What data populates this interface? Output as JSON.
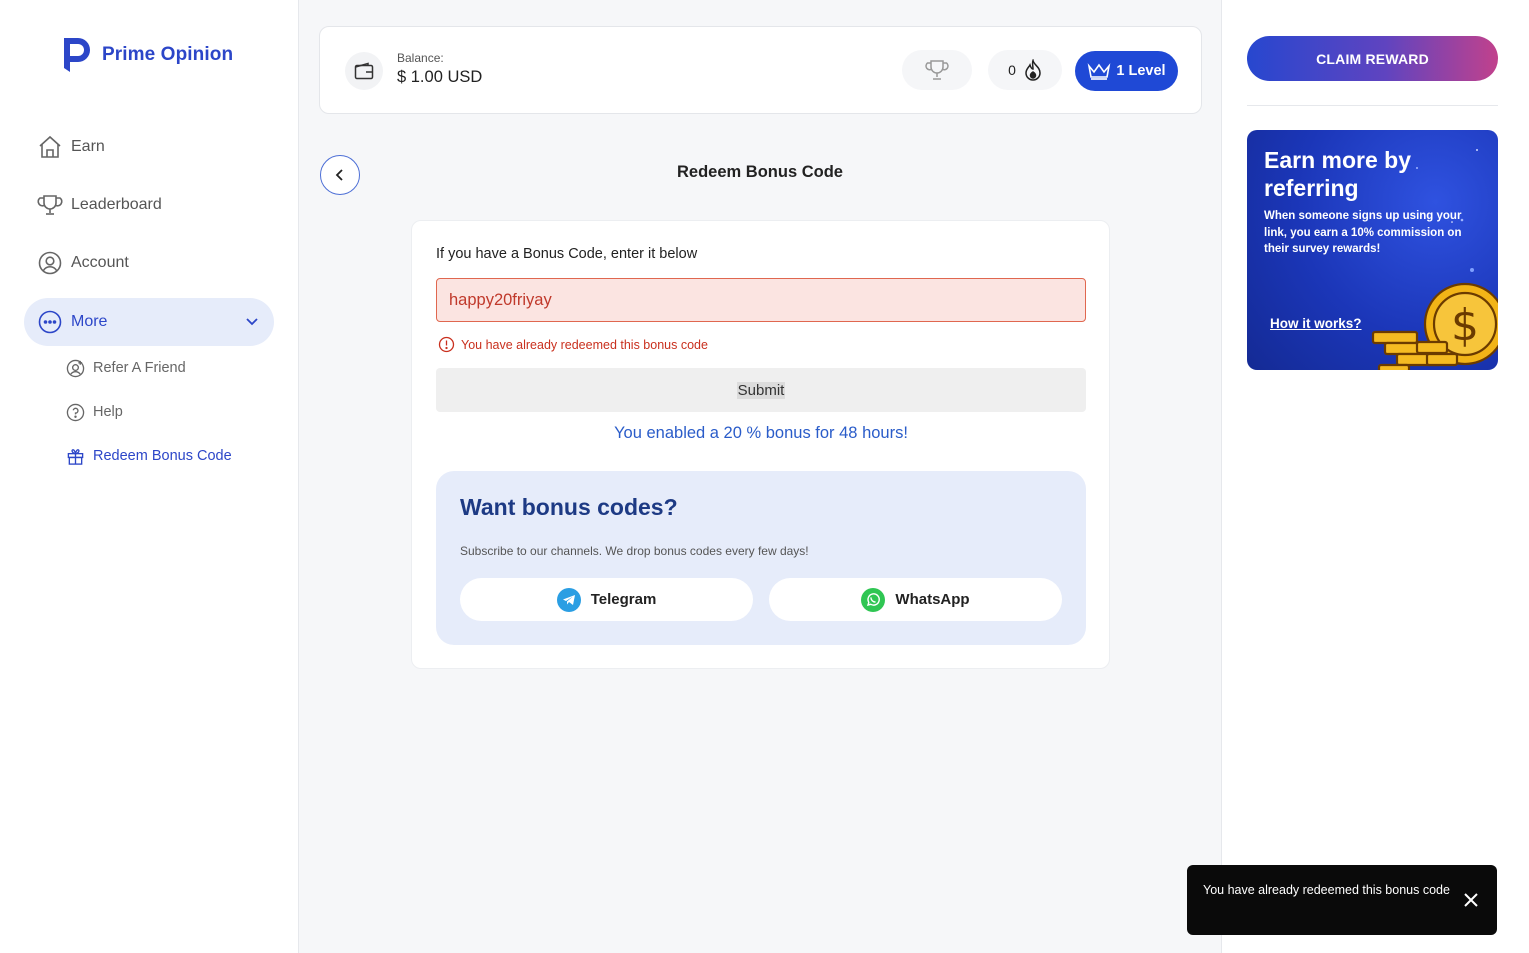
{
  "app": {
    "brand": "Prime Opinion"
  },
  "sidebar": {
    "items": [
      {
        "label": "Earn",
        "icon": "home-icon"
      },
      {
        "label": "Leaderboard",
        "icon": "trophy-icon"
      },
      {
        "label": "Account",
        "icon": "user-circle-icon"
      },
      {
        "label": "More",
        "icon": "more-circle-icon",
        "expanded": true
      }
    ],
    "sub_items": [
      {
        "label": "Refer A Friend",
        "icon": "refer-friend-icon"
      },
      {
        "label": "Help",
        "icon": "help-icon"
      },
      {
        "label": "Redeem Bonus Code",
        "icon": "gift-icon",
        "active": true
      }
    ]
  },
  "topbar": {
    "balance_label": "Balance:",
    "balance_value": "$ 1.00 USD",
    "streak_count": "0",
    "level_label": "1 Level"
  },
  "page": {
    "title": "Redeem Bonus Code",
    "instruction": "If you have a Bonus Code, enter it below",
    "code_value": "happy20friyay",
    "error_text": "You have already redeemed this bonus code",
    "submit_label": "Submit",
    "success_text": "You enabled a 20 % bonus for 48 hours!"
  },
  "promo": {
    "title": "Want bonus codes?",
    "subtitle": "Subscribe to our channels. We drop bonus codes every few days!",
    "telegram_label": "Telegram",
    "whatsapp_label": "WhatsApp"
  },
  "right_panel": {
    "claim_label": "CLAIM REWARD",
    "refer_title": "Earn more by referring",
    "refer_text": "When someone signs up using your link, you earn a 10% commission on their survey rewards!",
    "refer_link": "How it works?"
  },
  "toast": {
    "text": "You have already redeemed this bonus code"
  },
  "colors": {
    "brand_blue": "#2c46c8",
    "level_blue": "#1f49d6",
    "error_red": "#c9301e",
    "success_blue": "#2a5cc9",
    "promo_bg": "#e6ecfa"
  }
}
